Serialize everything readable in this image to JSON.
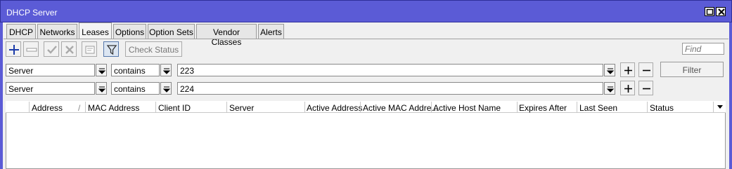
{
  "window": {
    "title": "DHCP Server"
  },
  "tabs": [
    {
      "label": "DHCP"
    },
    {
      "label": "Networks"
    },
    {
      "label": "Leases"
    },
    {
      "label": "Options"
    },
    {
      "label": "Option Sets"
    },
    {
      "label": "Vendor Classes"
    },
    {
      "label": "Alerts"
    }
  ],
  "active_tab": "Leases",
  "toolbar": {
    "icons": [
      "add-icon",
      "remove-icon",
      "enable-icon",
      "disable-icon",
      "comment-icon",
      "filter-icon"
    ],
    "check_status_label": "Check Status",
    "find_placeholder": "Find"
  },
  "filters": [
    {
      "field": "Server",
      "operator": "contains",
      "value": "223"
    },
    {
      "field": "Server",
      "operator": "contains",
      "value": "224"
    }
  ],
  "filter_button_label": "Filter",
  "table": {
    "columns": [
      "Address",
      "MAC Address",
      "Client ID",
      "Server",
      "Active Address",
      "Active MAC Addre...",
      "Active Host Name",
      "Expires After",
      "Last Seen",
      "Status"
    ],
    "sort_indicator": "/",
    "rows": []
  },
  "colors": {
    "titlebar": "#5b5bd6",
    "add_icon": "#1a3aa8"
  }
}
